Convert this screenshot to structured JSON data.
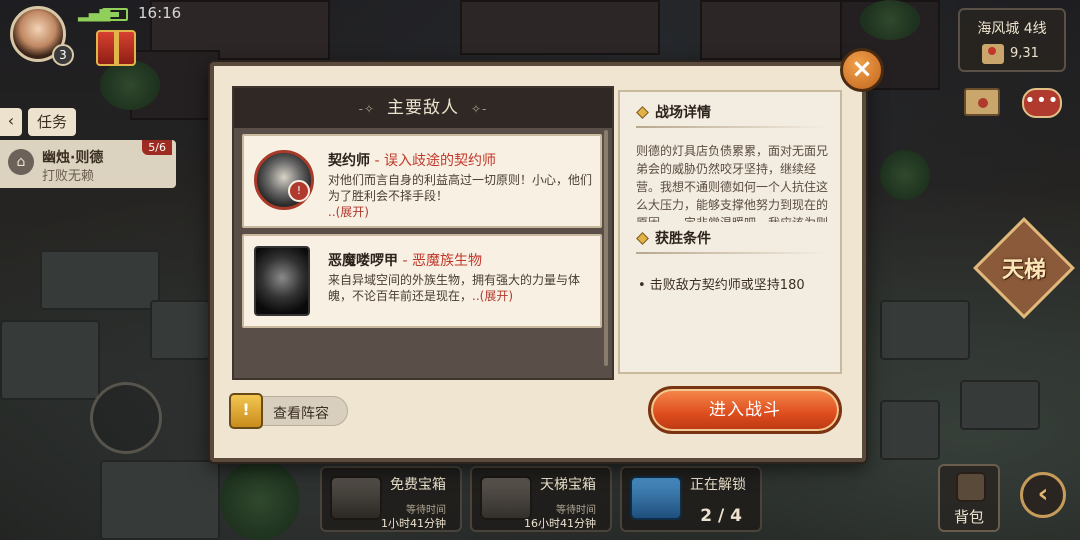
{
  "status_bar": {
    "time": "16:16"
  },
  "player": {
    "level": "3"
  },
  "quest": {
    "back_label": "‹",
    "tab_label": "任务",
    "title": "幽烛·则德",
    "subtitle": "打败无赖",
    "progress": "5/6"
  },
  "location": {
    "name": "海风城 4线",
    "coords": "9,31"
  },
  "ladder": {
    "label": "天梯"
  },
  "bag": {
    "label": "背包"
  },
  "nav": {
    "arrow": "‹"
  },
  "modal": {
    "close": "×",
    "enemy_header": "主要敌人",
    "header_deco_left": "-✧",
    "header_deco_right": "✧-",
    "enemies": [
      {
        "name": "契约师",
        "type": " - 误入歧途的契约师",
        "desc": "对他们而言自身的利益高过一切原则！小心，他们为了胜利会不择手段！",
        "expand": "..(展开)"
      },
      {
        "name": "恶魔喽啰甲",
        "type": " - 恶魔族生物",
        "desc": "来自异域空间的外族生物，拥有强大的力量与体魄，不论百年前还是现在，",
        "expand": "..(展开)"
      }
    ],
    "battle_details_title": "战场详情",
    "battle_details_text": "则德的灯具店负债累累，面对无面兄弟会的威胁仍然咬牙坚持，继续经营。我想不通则德如何一个人抗住这么大压力，能够支撑他努力到现在的原因，一定非常温暖吧。我应该为则德",
    "victory_title": "获胜条件",
    "victory_condition": "• 击败敌方契约师或坚持180",
    "lineup_button": "查看阵容",
    "enter_battle_button": "进入战斗"
  },
  "chests": [
    {
      "title": "免费宝箱",
      "wait": "等待时间",
      "time": "1小时41分钟"
    },
    {
      "title": "天梯宝箱",
      "wait": "等待时间",
      "time": "16小时41分钟"
    },
    {
      "title": "正在解锁",
      "count": "2 / 4"
    }
  ]
}
